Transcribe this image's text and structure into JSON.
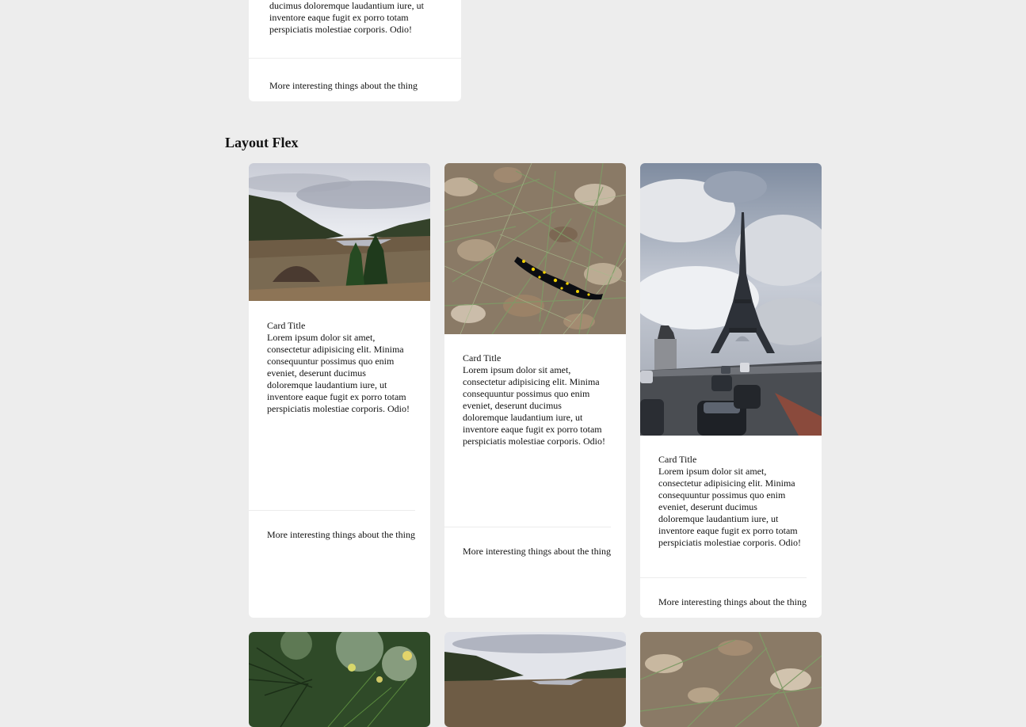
{
  "top_card": {
    "text_tail": "ducimus doloremque laudantium iure, ut inventore eaque fugit ex porro totam perspiciatis molestiae corporis. Odio!",
    "footer": "More interesting things about the thing"
  },
  "section": {
    "title": "Layout Flex"
  },
  "cards": [
    {
      "image": "landscape-valley-photo",
      "title": "Card Title",
      "text": "Lorem ipsum dolor sit amet, consectetur adipisicing elit. Minima consequuntur possimus quo enim eveniet, deserunt ducimus doloremque laudantium iure, ut inventore eaque fugit ex porro totam perspiciatis molestiae corporis. Odio!",
      "footer": "More interesting things about the thing"
    },
    {
      "image": "salamander-leaves-photo",
      "title": "Card Title",
      "text": "Lorem ipsum dolor sit amet, consectetur adipisicing elit. Minima consequuntur possimus quo enim eveniet, deserunt ducimus doloremque laudantium iure, ut inventore eaque fugit ex porro totam perspiciatis molestiae corporis. Odio!",
      "footer": "More interesting things about the thing"
    },
    {
      "image": "eiffel-tower-photo",
      "title": "Card Title",
      "text": "Lorem ipsum dolor sit amet, consectetur adipisicing elit. Minima consequuntur possimus quo enim eveniet, deserunt ducimus doloremque laudantium iure, ut inventore eaque fugit ex porro totam perspiciatis molestiae corporis. Odio!",
      "footer": "More interesting things about the thing"
    }
  ],
  "bottom_row_images": [
    "pine-branch-photo",
    "landscape-valley-photo",
    "salamander-leaves-photo"
  ]
}
